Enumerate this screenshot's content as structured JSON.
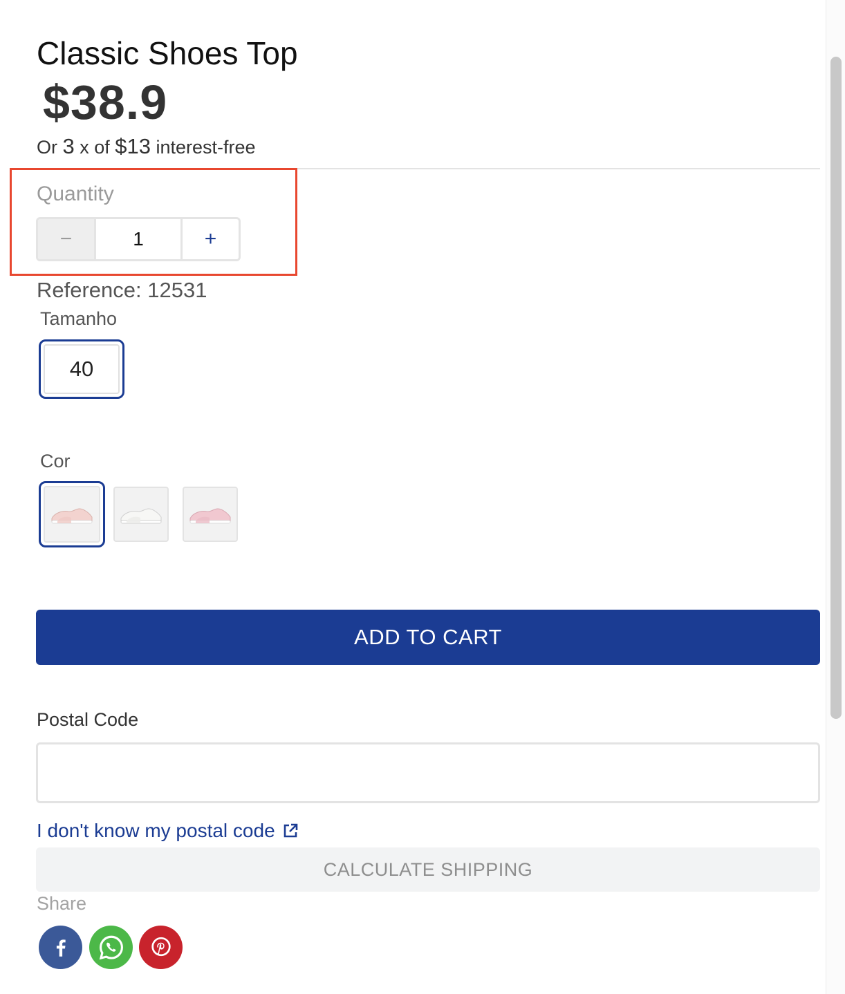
{
  "product": {
    "title": "Classic Shoes Top",
    "price": "$38.9",
    "installments_prefix": "Or ",
    "installments_count": "3",
    "installments_middle": " x of ",
    "installments_amount": "$13",
    "installments_suffix": " interest-free",
    "reference": "Reference: 12531"
  },
  "quantity": {
    "label": "Quantity",
    "value": "1",
    "decrement_symbol": "−",
    "increment_symbol": "+"
  },
  "size": {
    "label": "Tamanho",
    "options": [
      {
        "label": "40",
        "selected": true
      }
    ]
  },
  "color": {
    "label": "Cor",
    "options": [
      {
        "name": "light-pink-sneaker",
        "tone": "#f3d3cf",
        "selected": true
      },
      {
        "name": "white-sneaker",
        "tone": "#f4f4f2",
        "selected": false
      },
      {
        "name": "pink-sneaker",
        "tone": "#f1c8d0",
        "selected": false
      }
    ]
  },
  "actions": {
    "add_to_cart": "ADD TO CART",
    "calculate_shipping": "CALCULATE SHIPPING"
  },
  "shipping": {
    "postal_label": "Postal Code",
    "postal_value": "",
    "postal_placeholder": "",
    "postal_help_link": "I don't know my postal code",
    "postal_help_icon": "external-link-icon"
  },
  "share": {
    "label": "Share",
    "networks": [
      {
        "name": "facebook",
        "icon": "facebook-icon",
        "color": "#3b5998"
      },
      {
        "name": "whatsapp",
        "icon": "whatsapp-icon",
        "color": "#4cb848"
      },
      {
        "name": "pinterest",
        "icon": "pinterest-icon",
        "color": "#c8232c"
      }
    ]
  },
  "theme": {
    "accent": "#1b3c93",
    "highlight": "#e8472f",
    "muted_text": "#9a9a9a"
  }
}
